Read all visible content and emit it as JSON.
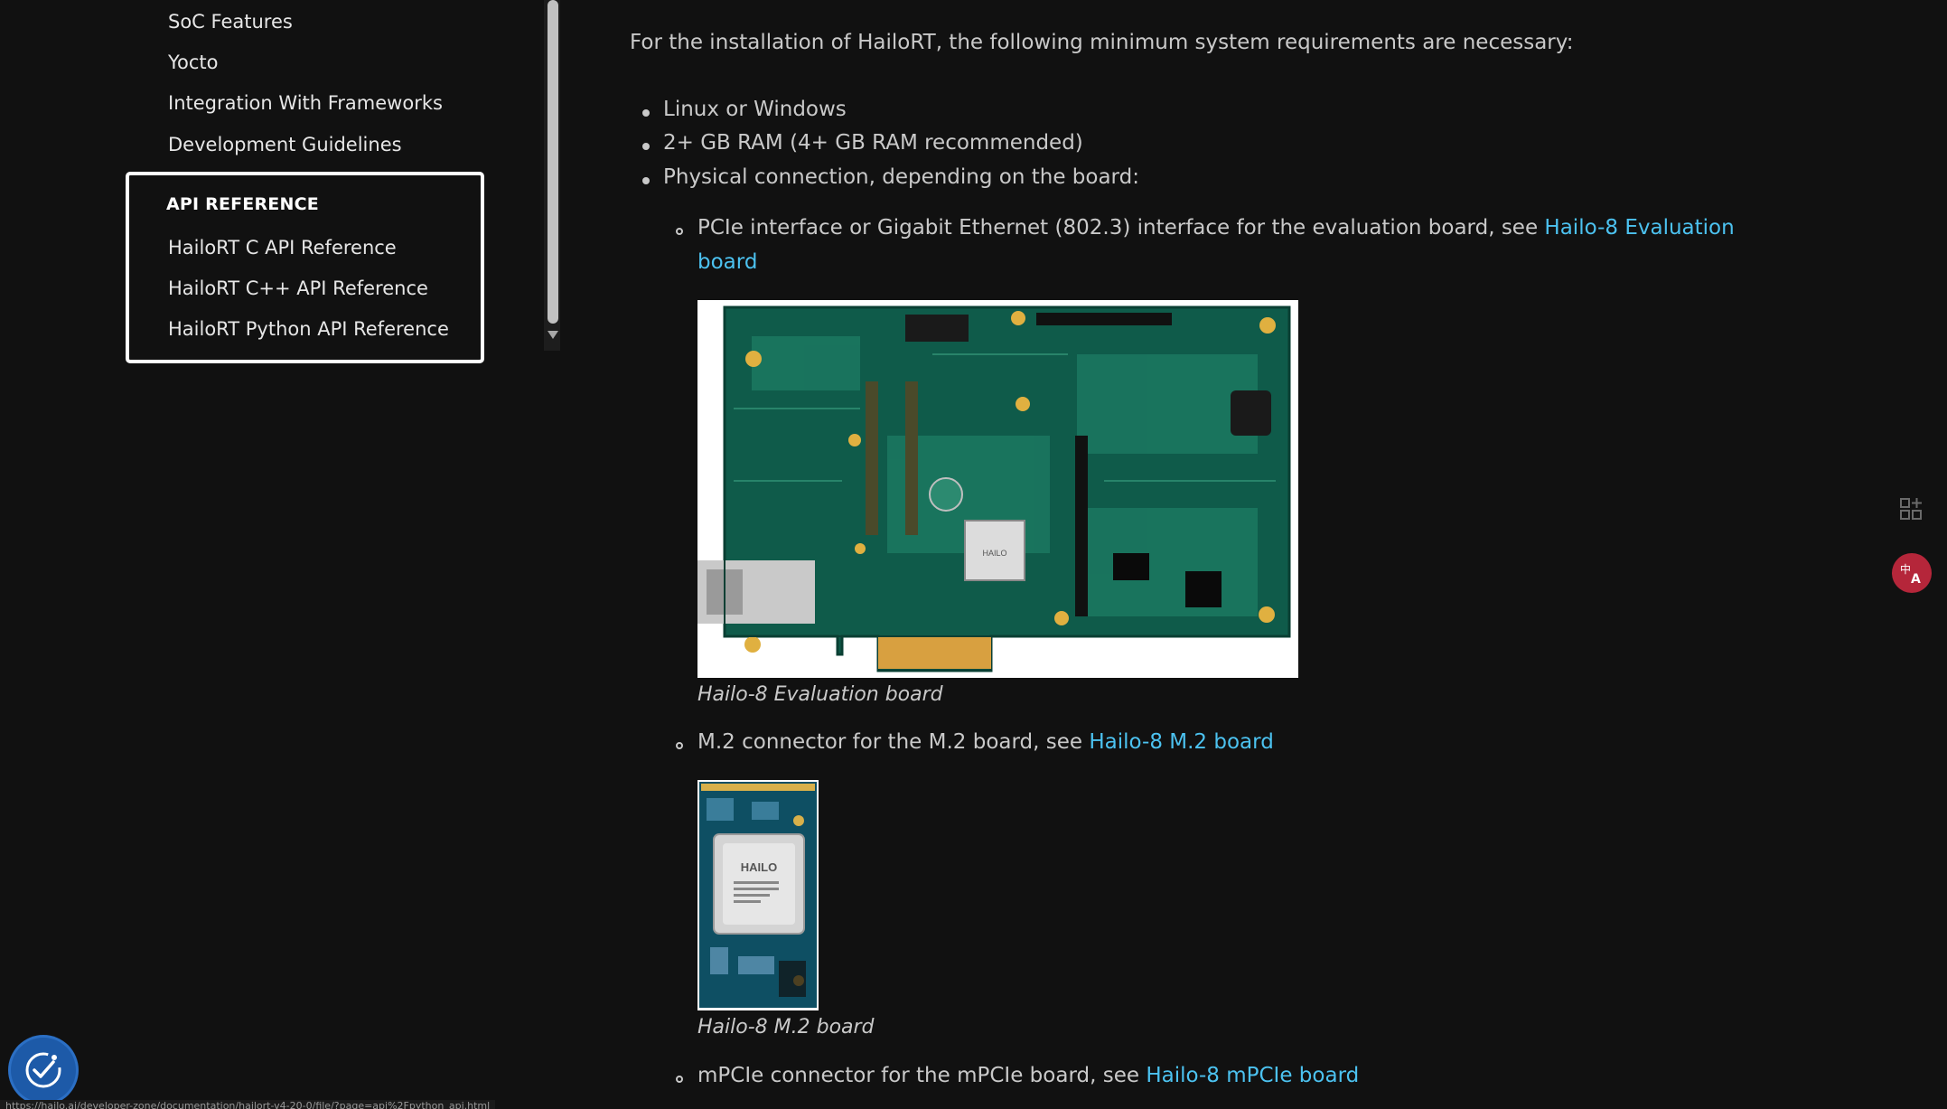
{
  "sidebar": {
    "items": [
      {
        "label": "SoC Features"
      },
      {
        "label": "Yocto"
      },
      {
        "label": "Integration With Frameworks"
      },
      {
        "label": "Development Guidelines"
      }
    ],
    "api_section": {
      "heading": "API REFERENCE",
      "items": [
        {
          "label": "HailoRT C API Reference"
        },
        {
          "label": "HailoRT C++ API Reference"
        },
        {
          "label": "HailoRT Python API Reference"
        }
      ]
    }
  },
  "content": {
    "intro": "For the installation of HailoRT, the following minimum system requirements are necessary:",
    "requirements": [
      "Linux or Windows",
      "2+ GB RAM (4+ GB RAM recommended)",
      "Physical connection, depending on the board:"
    ],
    "connections": [
      {
        "text": "PCIe interface or Gigabit Ethernet (802.3) interface for the evaluation board, see ",
        "link_line1": "Hailo-8 Evaluation",
        "link_line2": "board",
        "caption": "Hailo-8 Evaluation board"
      },
      {
        "text": "M.2 connector for the M.2 board, see ",
        "link": "Hailo-8 M.2 board",
        "caption": "Hailo-8 M.2 board"
      },
      {
        "text": "mPCIe connector for the mPCIe board, see ",
        "link": "Hailo-8 mPCIe board"
      }
    ],
    "chip_label": "HAILO"
  },
  "status_url": "https://hailo.ai/developer-zone/documentation/hailort-v4-20-0/file/?page=api%2Fpython_api.html",
  "icons": {
    "apps": "apps-add-icon",
    "translate": "translate-icon",
    "accessibility": "accessibility-icon"
  },
  "colors": {
    "background": "#111111",
    "link": "#4cc2f0",
    "text": "#c9c9c9",
    "translate_badge": "#b5263a",
    "accessibility_badge": "#1d5aa8"
  }
}
